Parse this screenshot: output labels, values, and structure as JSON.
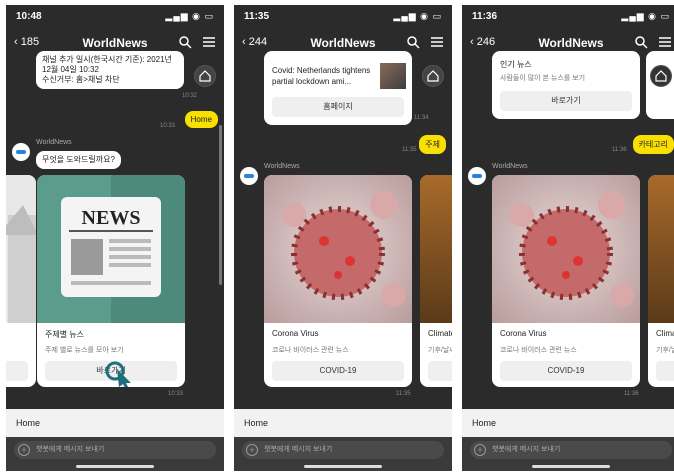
{
  "app": {
    "title": "WorldNews",
    "bot_name": "WorldNews"
  },
  "input": {
    "placeholder": "챗봇에게 메시지 보내기"
  },
  "screens": [
    {
      "time": "10:48",
      "back_count": "185",
      "msg_text": "채널 추가 일시(한국시간 기준): 2021년 12월 04일 10:32\n수신거부: 홈>채널 차단",
      "ts1": "10:32",
      "user_msg": "Home",
      "ts2": "10:33",
      "bot_prompt": "무엇을 도와드릴까요?",
      "card": {
        "title": "주제별 뉴스",
        "desc": "주제 별로 뉴스를 모아 보기",
        "button": "바로가기",
        "image": "NEWS"
      },
      "ts3": "10:33",
      "composer_home": "Home"
    },
    {
      "time": "11:35",
      "back_count": "244",
      "msg_text": "Covid: Netherlands tightens partial lockdown ami...",
      "msg_button": "홈페이지",
      "ts1": "11:34",
      "user_msg": "주제",
      "ts2": "11:35",
      "card": {
        "title": "Corona Virus",
        "desc": "코로나 바이러스 관련 뉴스",
        "button": "COVID-19"
      },
      "card2": {
        "title": "Climate",
        "desc": "기후/날씨"
      },
      "ts3": "11:35",
      "composer_home": "Home"
    },
    {
      "time": "11:36",
      "back_count": "246",
      "msg_title": "인기 뉴스",
      "msg_text": "사람들이 많이 본 뉴스를 보기",
      "msg_button": "바로가기",
      "user_msg": "카테고리",
      "ts2": "11:36",
      "card": {
        "title": "Corona Virus",
        "desc": "코로나 바이러스 관련 뉴스",
        "button": "COVID-19"
      },
      "card2": {
        "title": "Climat",
        "desc": "기후/날씨"
      },
      "ts3": "11:36",
      "composer_home": "Home"
    }
  ]
}
